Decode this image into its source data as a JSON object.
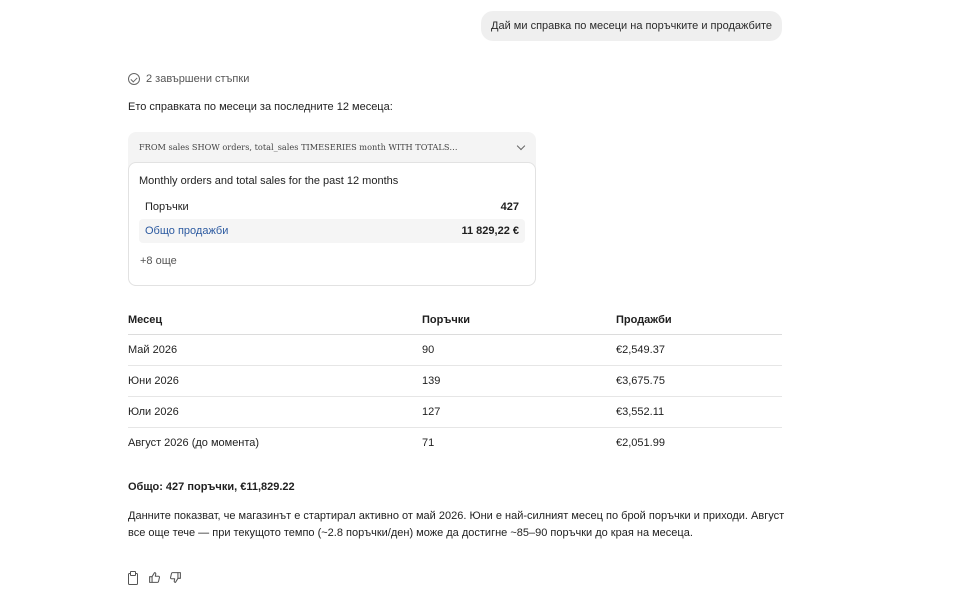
{
  "user_message": "Дай ми справка по месеци на поръчките и продажбите",
  "steps": {
    "label": "2 завършени стъпки"
  },
  "intro": "Ето справката по месеци за последните 12 месеца:",
  "tool": {
    "query": "FROM sales SHOW orders, total_sales TIMESERIES month WITH TOTALS…",
    "result_title": "Monthly orders and total sales for the past 12 months",
    "metrics": [
      {
        "label": "Поръчки",
        "value": "427"
      },
      {
        "label": "Общо продажби",
        "value": "11 829,22 €"
      }
    ],
    "more": "+8 още"
  },
  "table": {
    "headers": [
      "Месец",
      "Поръчки",
      "Продажби"
    ],
    "rows": [
      [
        "Май 2026",
        "90",
        "€2,549.37"
      ],
      [
        "Юни 2026",
        "139",
        "€3,675.75"
      ],
      [
        "Юли 2026",
        "127",
        "€3,552.11"
      ],
      [
        "Август 2026 (до момента)",
        "71",
        "€2,051.99"
      ]
    ]
  },
  "total": "Общо: 427 поръчки, €11,829.22",
  "summary": "Данните показват, че магазинът е стартирал активно от май 2026. Юни е най-силният месец по брой поръчки и приходи. Август все още тече — при текущото темпо (~2.8 поръчки/ден) може да достигне ~85–90 поръчки до края на месеца.",
  "actions": [
    "copy-icon",
    "thumbs-up-icon",
    "thumbs-down-icon"
  ]
}
